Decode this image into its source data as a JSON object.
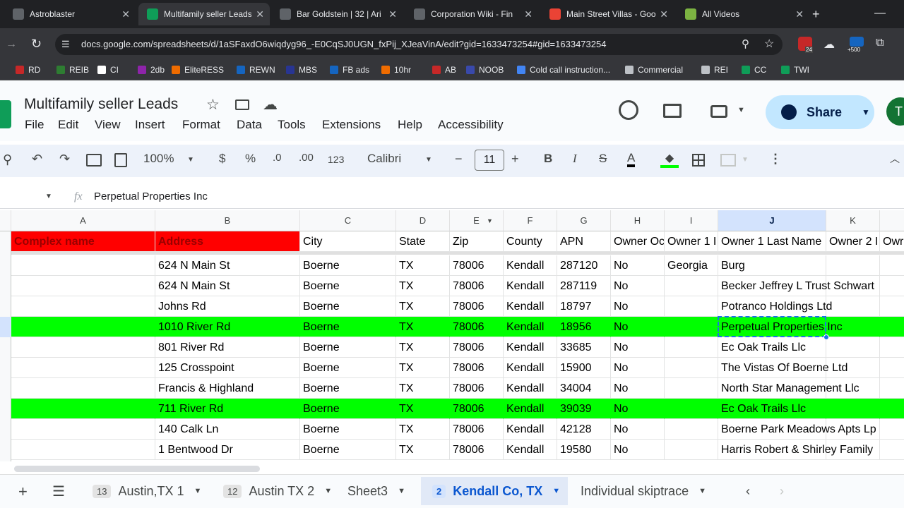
{
  "browser": {
    "tabs": [
      {
        "label": "Astroblaster",
        "color": "#5f6368"
      },
      {
        "label": "Multifamily seller Leads",
        "color": "#0f9d58"
      },
      {
        "label": "Bar Goldstein | 32 | Ari",
        "color": "#5f6368"
      },
      {
        "label": "Corporation Wiki - Fin",
        "color": "#5f6368"
      },
      {
        "label": "Main Street Villas - Goo",
        "color": "#ea4335"
      },
      {
        "label": "All Videos",
        "color": "#7cb342"
      }
    ],
    "url": "docs.google.com/spreadsheets/d/1aSFaxdO6wiqdyg96_-E0CqSJ0UGN_fxPij_XJeaVinA/edit?gid=1633473254#gid=1633473254",
    "ext_badge_1": "24",
    "ext_badge_2": "+500",
    "bookmarks": [
      "RD",
      "REIB",
      "CI",
      "2db",
      "EliteRESS",
      "REWN",
      "MBS",
      "FB ads",
      "10hr",
      "AB",
      "NOOB",
      "Cold call instruction...",
      "Commercial",
      "REI",
      "CC",
      "TWI"
    ]
  },
  "doc": {
    "title": "Multifamily seller Leads",
    "menu": [
      "File",
      "Edit",
      "View",
      "Insert",
      "Format",
      "Data",
      "Tools",
      "Extensions",
      "Help",
      "Accessibility"
    ],
    "share_label": "Share",
    "avatar_letter": "T"
  },
  "toolbar": {
    "zoom": "100%",
    "currency": "$",
    "percent": "%",
    "dec_minus": ".0",
    "dec_plus": ".00",
    "number_format": "123",
    "font": "Calibri",
    "font_size": "11",
    "bold": "B",
    "italic": "I",
    "strike": "S",
    "text_color": "A"
  },
  "formula_bar": {
    "fx": "fx",
    "value": "Perpetual Properties Inc"
  },
  "columns": [
    "A",
    "B",
    "C",
    "D",
    "E",
    "F",
    "G",
    "H",
    "I",
    "J",
    "K"
  ],
  "header_row": [
    "Complex name",
    "Address",
    "City",
    "State",
    "Zip",
    "County",
    "APN",
    "Owner Oc",
    "Owner 1 I",
    "Owner 1 Last Name",
    "Owner 2 I",
    "Owr"
  ],
  "rows": [
    {
      "cells": [
        "",
        "624 N Main St",
        "Boerne",
        "TX",
        "78006",
        "Kendall",
        "287120",
        "No",
        "Georgia",
        "Burg",
        "",
        ""
      ],
      "highlight": false
    },
    {
      "cells": [
        "",
        "624 N Main St",
        "Boerne",
        "TX",
        "78006",
        "Kendall",
        "287119",
        "No",
        "",
        "Becker Jeffrey L Trust Schwart",
        "",
        ""
      ],
      "highlight": false
    },
    {
      "cells": [
        "",
        "Johns Rd",
        "Boerne",
        "TX",
        "78006",
        "Kendall",
        "18797",
        "No",
        "",
        "Potranco Holdings Ltd",
        "",
        ""
      ],
      "highlight": false
    },
    {
      "cells": [
        "",
        "1010 River Rd",
        "Boerne",
        "TX",
        "78006",
        "Kendall",
        "18956",
        "No",
        "",
        "Perpetual Properties Inc",
        "",
        ""
      ],
      "highlight": true
    },
    {
      "cells": [
        "",
        "801 River Rd",
        "Boerne",
        "TX",
        "78006",
        "Kendall",
        "33685",
        "No",
        "",
        "Ec Oak Trails Llc",
        "",
        ""
      ],
      "highlight": false
    },
    {
      "cells": [
        "",
        "125 Crosspoint",
        "Boerne",
        "TX",
        "78006",
        "Kendall",
        "15900",
        "No",
        "",
        "The Vistas Of Boerne Ltd",
        "",
        ""
      ],
      "highlight": false
    },
    {
      "cells": [
        "",
        "Francis & Highland",
        "Boerne",
        "TX",
        "78006",
        "Kendall",
        "34004",
        "No",
        "",
        "North Star Management Llc",
        "",
        ""
      ],
      "highlight": false
    },
    {
      "cells": [
        "",
        "711 River Rd",
        "Boerne",
        "TX",
        "78006",
        "Kendall",
        "39039",
        "No",
        "",
        "Ec Oak Trails Llc",
        "",
        ""
      ],
      "highlight": true
    },
    {
      "cells": [
        "",
        "140 Calk Ln",
        "Boerne",
        "TX",
        "78006",
        "Kendall",
        "42128",
        "No",
        "",
        "Boerne Park Meadows Apts Lp",
        "",
        ""
      ],
      "highlight": false
    },
    {
      "cells": [
        "",
        "1 Bentwood Dr",
        "Boerne",
        "TX",
        "78006",
        "Kendall",
        "19580",
        "No",
        "",
        "Harris Robert & Shirley Family",
        "",
        ""
      ],
      "highlight": false
    }
  ],
  "colors": {
    "highlight": "#00ff00",
    "header_red": "#ff0000",
    "header_red_text": "#990000",
    "selection": "#1a73e8"
  },
  "sheets": [
    {
      "badge": "13",
      "label": "Austin,TX 1",
      "active": false
    },
    {
      "badge": "12",
      "label": "Austin TX 2",
      "active": false
    },
    {
      "badge": "",
      "label": "Sheet3",
      "active": false
    },
    {
      "badge": "2",
      "label": "Kendall Co, TX",
      "active": true
    },
    {
      "badge": "",
      "label": "Individual skiptrace",
      "active": false
    }
  ]
}
